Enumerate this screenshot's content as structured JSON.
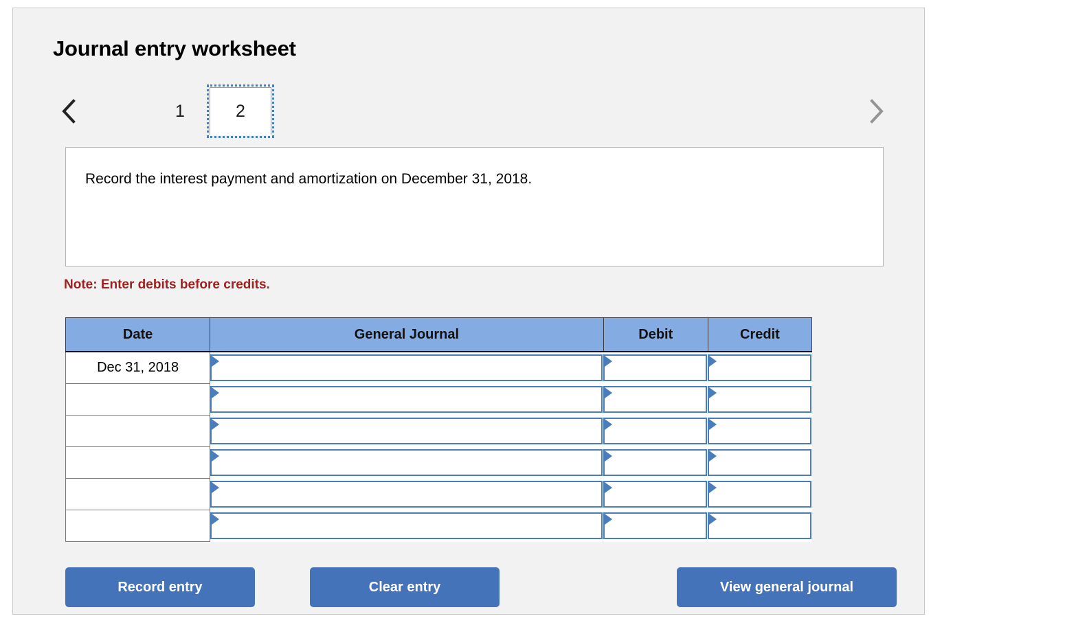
{
  "panel": {
    "title": "Journal entry worksheet"
  },
  "pager": {
    "prev_icon": "chevron-left-icon",
    "next_icon": "chevron-right-icon",
    "tabs": [
      {
        "label": "1",
        "selected": false
      },
      {
        "label": "2",
        "selected": true
      }
    ]
  },
  "description": {
    "text": "Record the interest payment and amortization on December 31, 2018."
  },
  "note": {
    "text": "Note: Enter debits before credits."
  },
  "table": {
    "headers": {
      "date": "Date",
      "general_journal": "General Journal",
      "debit": "Debit",
      "credit": "Credit"
    },
    "rows": [
      {
        "date": "Dec 31, 2018",
        "general_journal": "",
        "debit": "",
        "credit": ""
      },
      {
        "date": "",
        "general_journal": "",
        "debit": "",
        "credit": ""
      },
      {
        "date": "",
        "general_journal": "",
        "debit": "",
        "credit": ""
      },
      {
        "date": "",
        "general_journal": "",
        "debit": "",
        "credit": ""
      },
      {
        "date": "",
        "general_journal": "",
        "debit": "",
        "credit": ""
      },
      {
        "date": "",
        "general_journal": "",
        "debit": "",
        "credit": ""
      }
    ]
  },
  "buttons": {
    "record": "Record entry",
    "clear": "Clear entry",
    "view": "View general journal"
  },
  "colors": {
    "panel_bg": "#f2f2f2",
    "table_header_blue": "#85ace2",
    "button_blue": "#4573b9",
    "note_red": "#9c2220",
    "field_border_blue": "#4a7ebb",
    "chevron_prev": "#222222",
    "chevron_next": "#949494"
  }
}
